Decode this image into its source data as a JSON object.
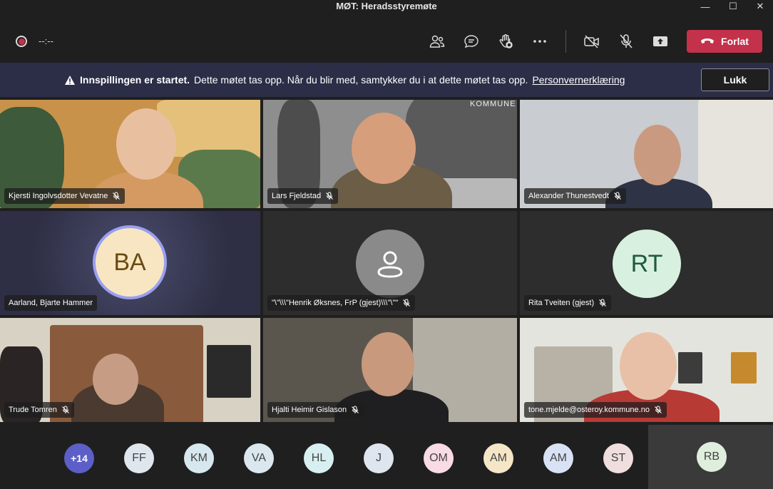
{
  "window": {
    "title": "MØT: Heradsstyremøte"
  },
  "controls": {
    "timer": "--:--",
    "leave_label": "Forlat"
  },
  "banner": {
    "title": "Innspillingen er startet.",
    "message": "Dette møtet tas opp. Når du blir med, samtykker du i at dette møtet tas opp.",
    "link": "Personvernerklæring",
    "close_label": "Lukk"
  },
  "video_background_text": "KOMMUNE",
  "tiles": [
    {
      "name": "Kjersti Ingolvsdotter Vevatne",
      "muted": true
    },
    {
      "name": "Lars Fjeldstad",
      "muted": true
    },
    {
      "name": "Alexander Thunestvedt",
      "muted": true
    },
    {
      "name": "Aarland, Bjarte Hammer",
      "initials": "BA",
      "avatar_color": "#f8e6c2"
    },
    {
      "name": "\"\\\"\\\\\\\"Henrik Øksnes, FrP (gjest)\\\\\\\"\\\"\"",
      "muted": true
    },
    {
      "name": "Rita Tveiten (gjest)",
      "initials": "RT",
      "avatar_color": "#d8f0e0",
      "muted": true
    },
    {
      "name": "Trude Tomren",
      "muted": true
    },
    {
      "name": "Hjalti Heimir Gislason",
      "muted": true
    },
    {
      "name": "tone.mjelde@osteroy.kommune.no",
      "muted": true
    }
  ],
  "participants_overflow": "+14",
  "participants": [
    {
      "initials": "FF",
      "color": "#dfe6ee"
    },
    {
      "initials": "KM",
      "color": "#d6e8ee"
    },
    {
      "initials": "VA",
      "color": "#dbe7ef"
    },
    {
      "initials": "HL",
      "color": "#d7eff0"
    },
    {
      "initials": "J",
      "color": "#dde6ee"
    },
    {
      "initials": "OM",
      "color": "#f8dbe4"
    },
    {
      "initials": "AM",
      "color": "#f6e6c8"
    },
    {
      "initials": "AM",
      "color": "#d8e2f4"
    },
    {
      "initials": "ST",
      "color": "#f0dede"
    },
    {
      "initials": "RB",
      "color": "#dfeedd"
    }
  ],
  "colors": {
    "accent": "#5b5fc7",
    "leave": "#c4314b",
    "banner": "#2c2e48"
  }
}
